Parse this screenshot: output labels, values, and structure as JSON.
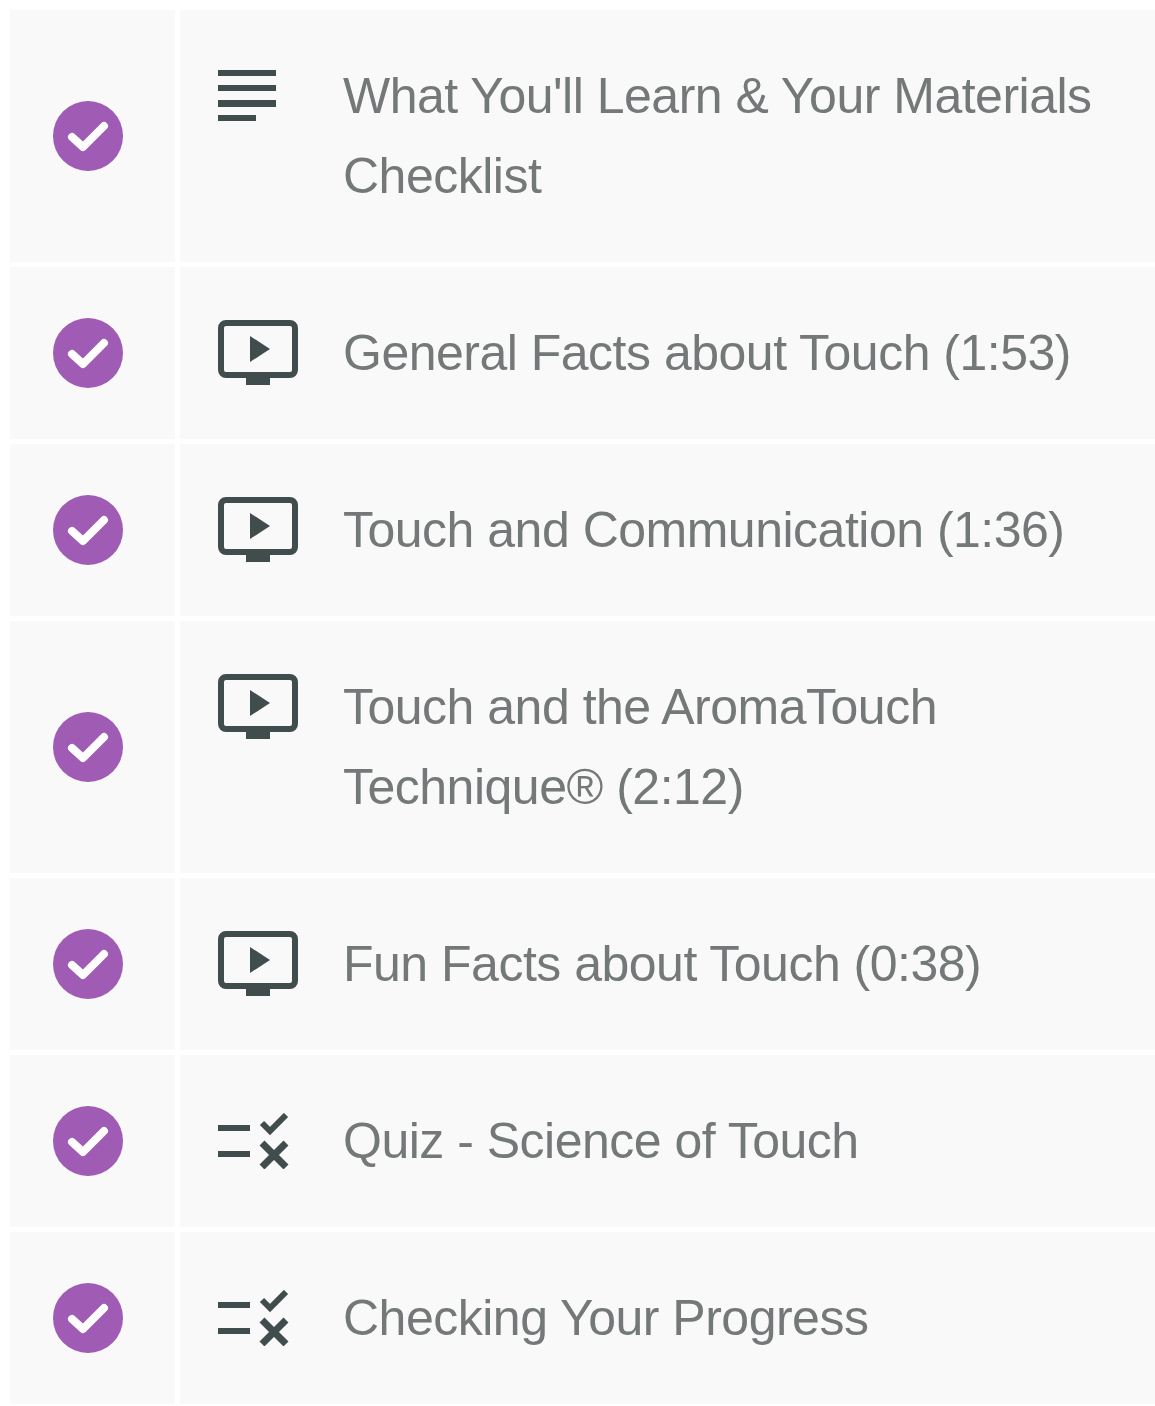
{
  "lessons": [
    {
      "kind": "text",
      "title": "What You'll Learn & Your Materials Checklist",
      "completed": true
    },
    {
      "kind": "video",
      "title": "General Facts about Touch (1:53)",
      "completed": true
    },
    {
      "kind": "video",
      "title": "Touch and Communication (1:36)",
      "completed": true
    },
    {
      "kind": "video",
      "title": "Touch and the AromaTouch Technique® (2:12)",
      "completed": true
    },
    {
      "kind": "video",
      "title": "Fun Facts about Touch (0:38)",
      "completed": true
    },
    {
      "kind": "quiz",
      "title": "Quiz - Science of Touch",
      "completed": true
    },
    {
      "kind": "quiz",
      "title": "Checking Your Progress",
      "completed": true
    }
  ]
}
